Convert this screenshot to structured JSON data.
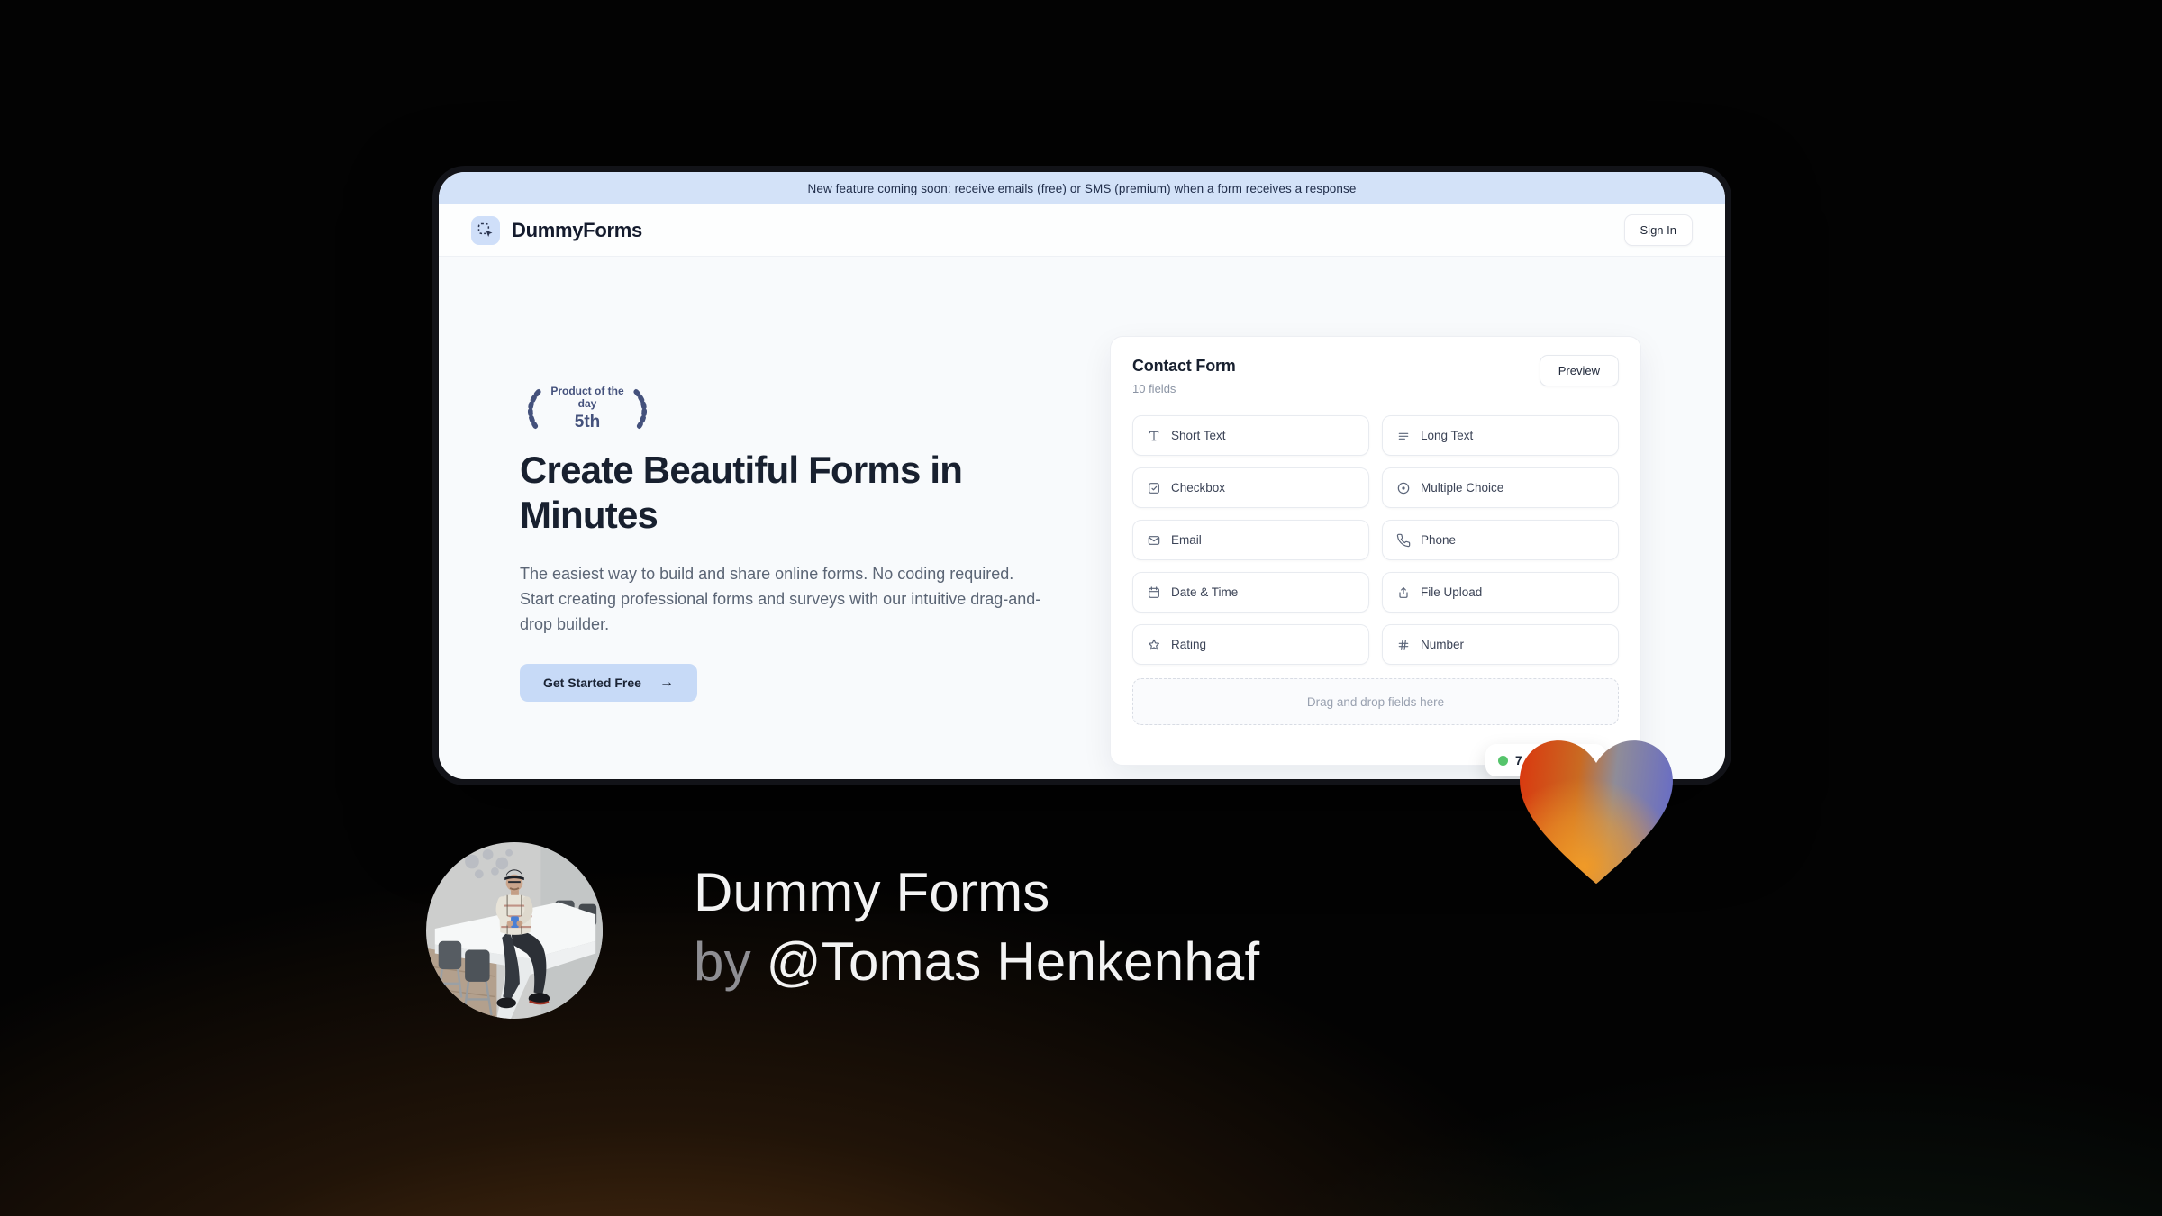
{
  "banner": {
    "text": "New feature coming soon: receive emails (free) or SMS (premium) when a form receives a response"
  },
  "header": {
    "brand": "DummyForms",
    "sign_in_label": "Sign In"
  },
  "hero": {
    "badge": {
      "line1": "Product of the day",
      "line2": "5th"
    },
    "title": "Create Beautiful Forms in Minutes",
    "description": "The easiest way to build and share online forms. No coding required. Start creating professional forms and surveys with our intuitive drag-and-drop builder.",
    "cta_label": "Get Started Free",
    "cta_arrow": "→"
  },
  "form_panel": {
    "title": "Contact Form",
    "subtitle": "10 fields",
    "preview_label": "Preview",
    "fields": [
      {
        "label": "Short Text",
        "icon": "type-icon"
      },
      {
        "label": "Long Text",
        "icon": "align-left-icon"
      },
      {
        "label": "Checkbox",
        "icon": "checkbox-icon"
      },
      {
        "label": "Multiple Choice",
        "icon": "radio-circle-icon"
      },
      {
        "label": "Email",
        "icon": "envelope-icon"
      },
      {
        "label": "Phone",
        "icon": "phone-icon"
      },
      {
        "label": "Date & Time",
        "icon": "calendar-icon"
      },
      {
        "label": "File Upload",
        "icon": "upload-icon"
      },
      {
        "label": "Rating",
        "icon": "star-icon"
      },
      {
        "label": "Number",
        "icon": "hash-icon"
      }
    ],
    "dropzone_text": "Drag and drop fields here",
    "online_badge": {
      "count": "7"
    }
  },
  "footer": {
    "line1": "Dummy Forms",
    "by_prefix": "by",
    "author": "@Tomas Henkenhaf"
  },
  "colors": {
    "banner_blue": "#d3e2f8",
    "accent_blue": "#c7daf7",
    "navy_text": "#18202f",
    "laurel_navy": "#44517c",
    "green_dot": "#55c46b",
    "heart_red": "#dd3a12",
    "heart_orange": "#f09a27",
    "heart_purple": "#6a6ec3"
  }
}
